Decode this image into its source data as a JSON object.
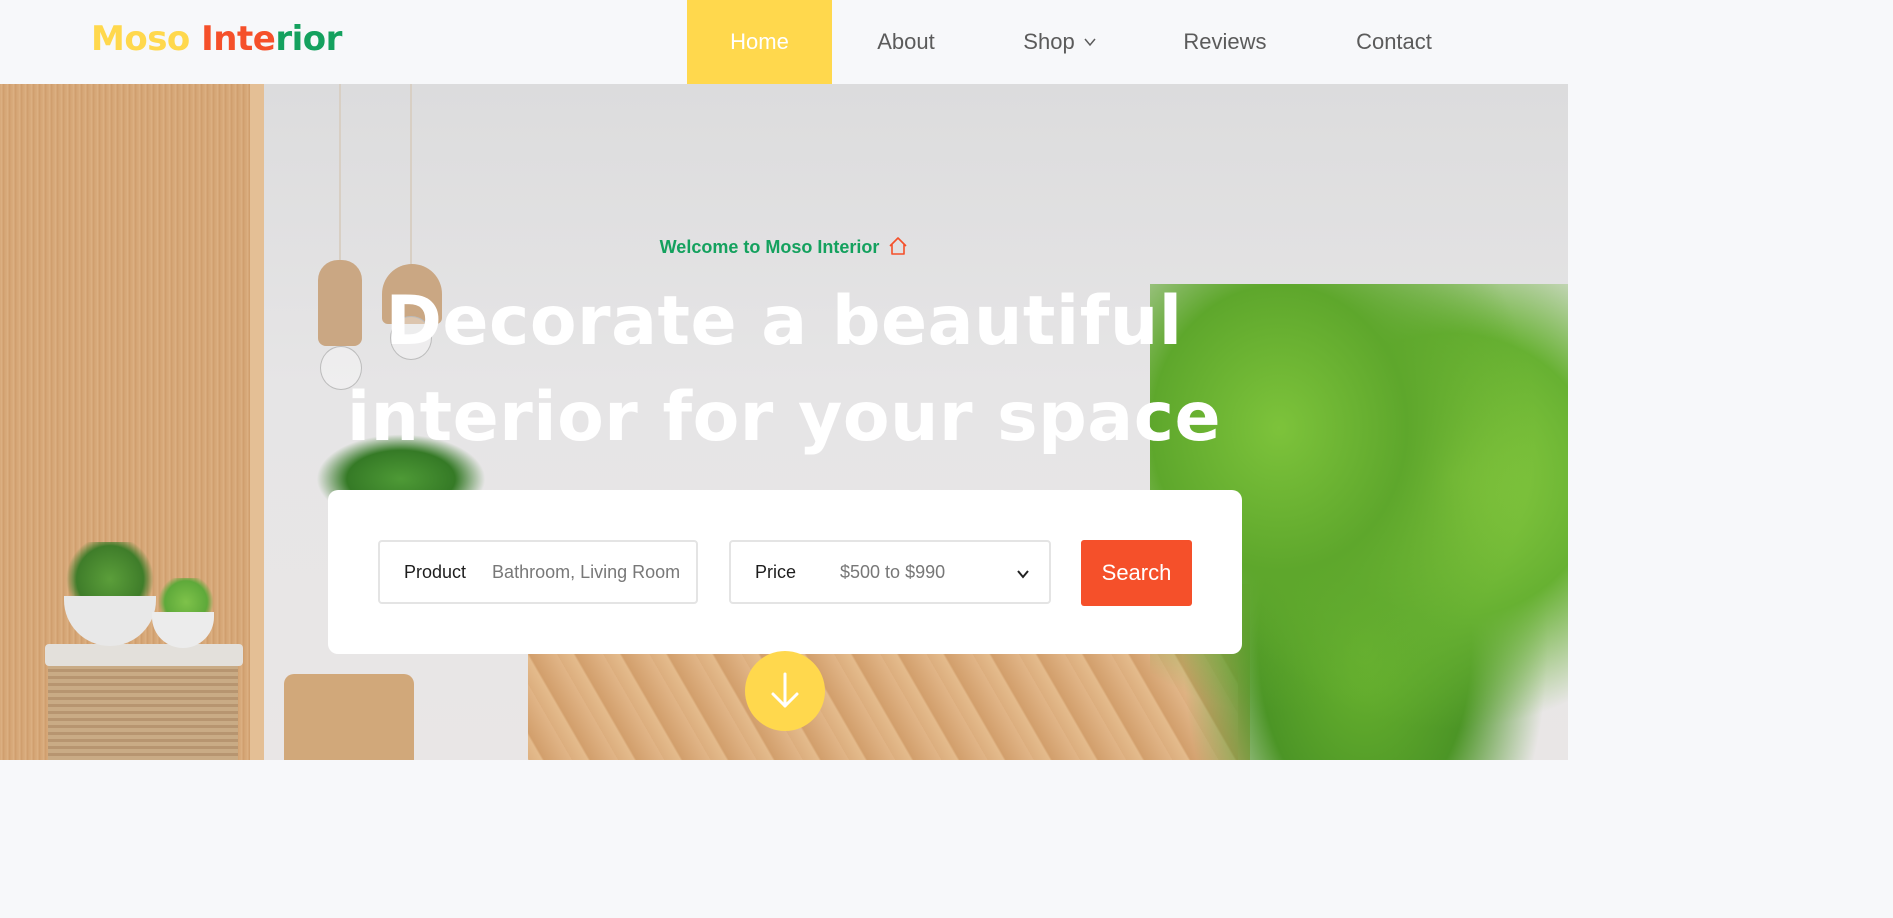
{
  "logo": {
    "part1": "Moso",
    "part2": "Inte",
    "part3": "rior"
  },
  "nav": {
    "items": [
      {
        "label": "Home",
        "active": true
      },
      {
        "label": "About"
      },
      {
        "label": "Shop",
        "icon": "chevron-down-icon"
      },
      {
        "label": "Reviews"
      },
      {
        "label": "Contact"
      }
    ]
  },
  "hero": {
    "welcome": "Welcome to Moso Interior",
    "welcome_icon": "home-icon",
    "headline_line1": "Decorate a beautiful",
    "headline_line2": "interior for your space",
    "scroll_icon": "arrow-down-icon"
  },
  "search": {
    "product_label": "Product",
    "product_placeholder": "Bathroom, Living Room",
    "price_label": "Price",
    "price_value": "$500 to $990",
    "button_label": "Search"
  },
  "colors": {
    "yellow": "#ffd84d",
    "orange": "#f5502a",
    "green": "#14a15e",
    "header_bg": "#f7f8fa"
  }
}
